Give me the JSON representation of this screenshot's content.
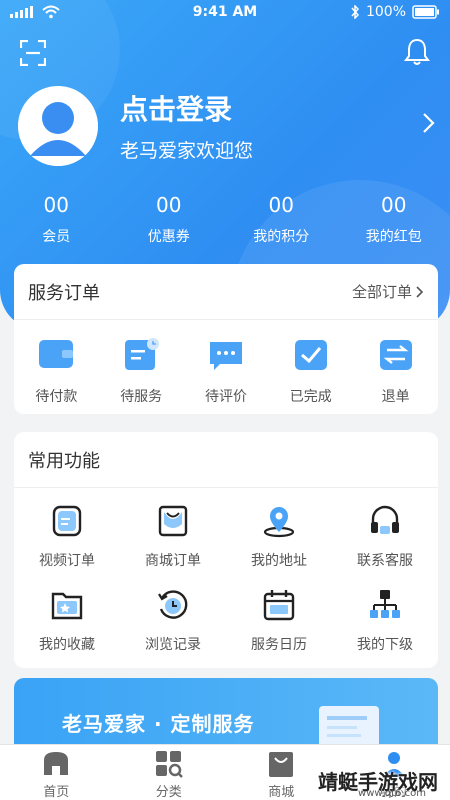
{
  "status_bar": {
    "time": "9:41 AM",
    "battery": "100%"
  },
  "profile": {
    "title": "点击登录",
    "subtitle": "老马爱家欢迎您"
  },
  "stats": [
    {
      "value": "00",
      "label": "会员"
    },
    {
      "value": "00",
      "label": "优惠券"
    },
    {
      "value": "00",
      "label": "我的积分"
    },
    {
      "value": "00",
      "label": "我的红包"
    }
  ],
  "orders": {
    "title": "服务订单",
    "all_label": "全部订单",
    "items": [
      {
        "label": "待付款",
        "icon": "wallet-icon"
      },
      {
        "label": "待服务",
        "icon": "clipboard-clock-icon"
      },
      {
        "label": "待评价",
        "icon": "chat-bubble-icon"
      },
      {
        "label": "已完成",
        "icon": "checkbox-icon"
      },
      {
        "label": "退单",
        "icon": "swap-arrows-icon"
      }
    ]
  },
  "functions": {
    "title": "常用功能",
    "items": [
      {
        "label": "视频订单",
        "icon": "video-order-icon"
      },
      {
        "label": "商城订单",
        "icon": "shopping-bag-icon"
      },
      {
        "label": "我的地址",
        "icon": "location-pin-icon"
      },
      {
        "label": "联系客服",
        "icon": "headset-icon"
      },
      {
        "label": "我的收藏",
        "icon": "folder-star-icon"
      },
      {
        "label": "浏览记录",
        "icon": "history-clock-icon"
      },
      {
        "label": "服务日历",
        "icon": "calendar-icon"
      },
      {
        "label": "我的下级",
        "icon": "org-tree-icon"
      }
    ]
  },
  "banner": {
    "text": "老马爱家 · 定制服务"
  },
  "tabs": [
    {
      "label": "首页",
      "icon": "home-icon"
    },
    {
      "label": "分类",
      "icon": "category-icon"
    },
    {
      "label": "商城",
      "icon": "shop-icon"
    },
    {
      "label": "我的",
      "icon": "profile-icon"
    }
  ],
  "watermark": {
    "text": "靖蜓手游戏网",
    "url": "www.qt6.com"
  },
  "colors": {
    "primary": "#2f8ef2",
    "icon_blue": "#4aa3f7",
    "icon_dark": "#222222"
  }
}
